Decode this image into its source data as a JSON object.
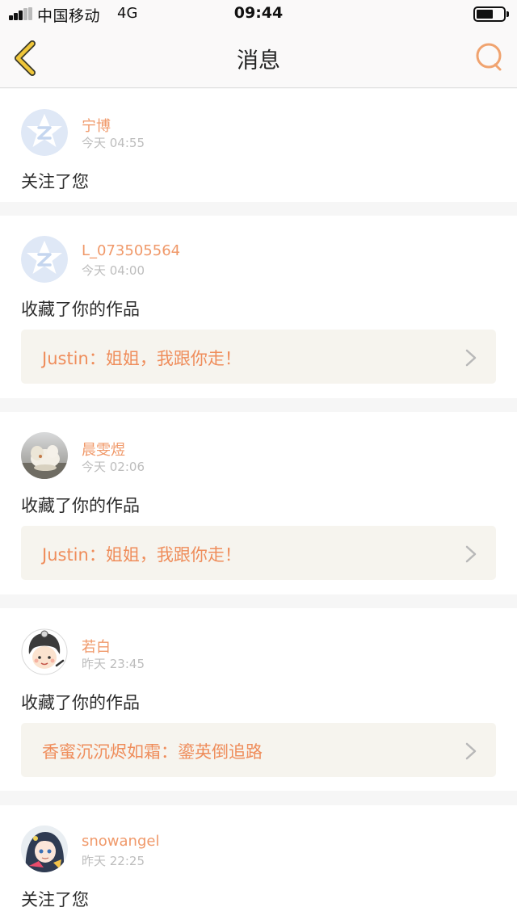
{
  "status_bar": {
    "carrier": "中国移动",
    "network": "4G",
    "time": "09:44"
  },
  "nav": {
    "back_icon": "chevron-left-icon",
    "title": "消息",
    "search_icon": "search-icon"
  },
  "colors": {
    "accent": "#f0996a",
    "back_chevron": "#efc63a",
    "work_bg": "#f6f4ee"
  },
  "notifications": [
    {
      "user": "宁博",
      "time": "今天 04:55",
      "action": "关注了您",
      "avatar": "default-qzone-avatar"
    },
    {
      "user": "L_073505564",
      "time": "今天 04:00",
      "action": "收藏了你的作品",
      "work": "Justin：姐姐，我跟你走！",
      "avatar": "default-qzone-avatar"
    },
    {
      "user": "晨雯煜",
      "time": "今天 02:06",
      "action": "收藏了你的作品",
      "work": "Justin：姐姐，我跟你走！",
      "avatar": "photo-avatar"
    },
    {
      "user": "若白",
      "time": "昨天 23:45",
      "action": "收藏了你的作品",
      "work": "香蜜沉沉烬如霜：鎏英倒追路",
      "avatar": "cartoon-avatar"
    },
    {
      "user": "snowangel",
      "time": "昨天 22:25",
      "action": "关注了您",
      "avatar": "anime-avatar"
    }
  ]
}
